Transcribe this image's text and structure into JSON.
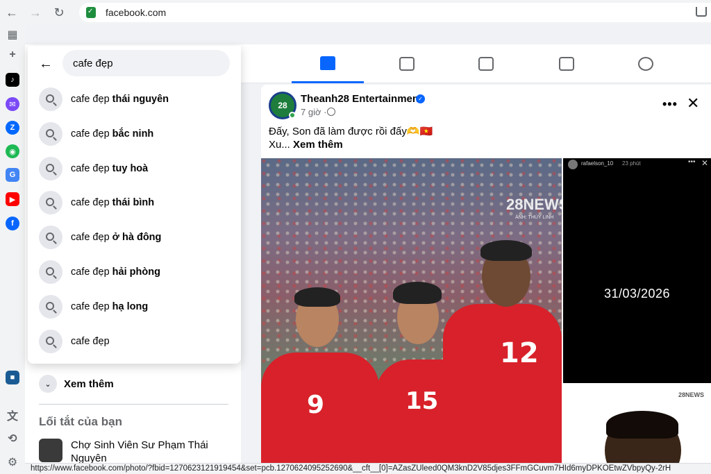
{
  "browser": {
    "url": "facebook.com",
    "status_url": "https://www.facebook.com/photo/?fbid=1270623121919454&set=pcb.1270624095252690&__cft__[0]=AZasZUleed0QM3knD2V85djes3FFmGCuvm7HId6myDPKOEtwZVbpyQy-2rH"
  },
  "icons": {
    "back": "←",
    "forward": "→",
    "reload": "↻",
    "apps": "▦",
    "add": "+",
    "translate": "文",
    "history": "⟲",
    "settings": "⚙",
    "search_back": "←",
    "chevron": "⌄",
    "more": "•••",
    "close": "✕",
    "verified": "✓"
  },
  "apps": [
    {
      "name": "tiktok",
      "color": "#000000",
      "glyph": "♪"
    },
    {
      "name": "messenger",
      "color": "#7b49f7",
      "glyph": "✉"
    },
    {
      "name": "zalo",
      "color": "#0068ff",
      "glyph": "Z"
    },
    {
      "name": "game",
      "color": "#1db954",
      "glyph": "◉"
    },
    {
      "name": "translate",
      "color": "#4285f4",
      "glyph": "G"
    },
    {
      "name": "youtube",
      "color": "#ff0000",
      "glyph": "▶"
    },
    {
      "name": "facebook",
      "color": "#0866ff",
      "glyph": "f"
    },
    {
      "name": "bottom-app",
      "color": "#1a5b94",
      "glyph": "■"
    }
  ],
  "search": {
    "query": "cafe đẹp",
    "prefix": "cafe đẹp",
    "suggestions": [
      {
        "suffix": "thái nguyên"
      },
      {
        "suffix": "bắc ninh"
      },
      {
        "suffix": "tuy hoà"
      },
      {
        "suffix": "thái bình"
      },
      {
        "suffix": "ở hà đông"
      },
      {
        "suffix": "hải phòng"
      },
      {
        "suffix": "hạ long"
      },
      {
        "suffix": ""
      }
    ]
  },
  "sidebar": {
    "see_more": "Xem thêm",
    "shortcuts_title": "Lối tắt của bạn",
    "shortcut_name": "Chợ Sinh Viên Sư Phạm Thái Nguyên"
  },
  "post": {
    "page_name": "Theanh28 Entertainment",
    "time": "7 giờ ·",
    "text_line1": "Đấy, Son đã làm được rồi đấy🫶🇻🇳",
    "text_prefix": "Xu...",
    "see_more": "Xem thêm",
    "avatar_text": "28"
  },
  "photo": {
    "watermark": "28NEWS",
    "watermark_sub": "ẢNH: THÙY LINH",
    "numbers": [
      "9",
      "15",
      "12"
    ]
  },
  "story": {
    "user": "rafaelson_10",
    "time": "23 phút",
    "date": "31/03/2026",
    "bottom_logo": "28NEWS"
  },
  "colors": {
    "accent": "#0866ff",
    "jersey": "#d8212a"
  }
}
